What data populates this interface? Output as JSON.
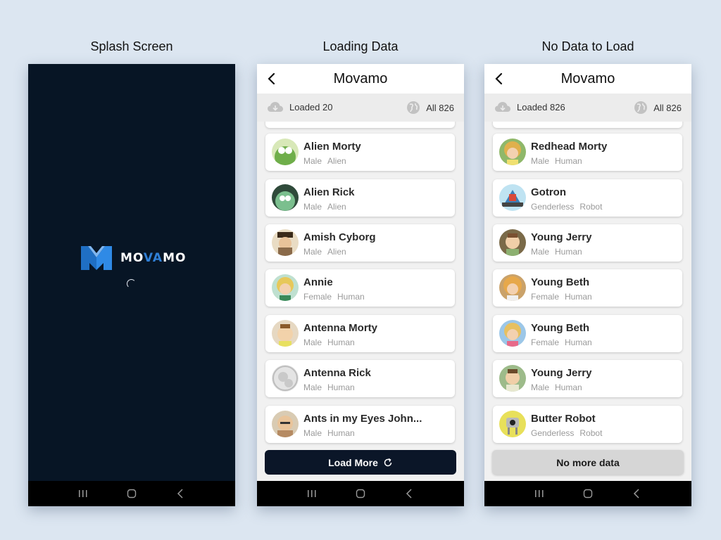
{
  "columns": {
    "splash_title": "Splash Screen",
    "loading_title": "Loading Data",
    "nodata_title": "No Data to Load"
  },
  "splash": {
    "logo_prefix": "MO",
    "logo_accent": "VA",
    "logo_suffix": "MO",
    "background_color": "#071525",
    "accent_color": "#2f7fd6"
  },
  "icons": {
    "back": "chevron-left-icon",
    "cloud": "cloud-download-icon",
    "globe": "globe-icon",
    "refresh": "refresh-icon",
    "nav_recents": "recents-icon",
    "nav_home": "home-icon",
    "nav_back": "back-icon"
  },
  "loading": {
    "app_title": "Movamo",
    "loaded_text": "Loaded 20",
    "total_text": "All 826",
    "button_label": "Load More",
    "button_color": "#0b1628",
    "characters": [
      {
        "name": "Alien Morty",
        "gender": "Male",
        "species": "Alien",
        "avatar": "#6fae4a"
      },
      {
        "name": "Alien Rick",
        "gender": "Male",
        "species": "Alien",
        "avatar": "#7bbf8e"
      },
      {
        "name": "Amish Cyborg",
        "gender": "Male",
        "species": "Alien",
        "avatar": "#8a6a4a"
      },
      {
        "name": "Annie",
        "gender": "Female",
        "species": "Human",
        "avatar": "#e7c85a"
      },
      {
        "name": "Antenna Morty",
        "gender": "Male",
        "species": "Human",
        "avatar": "#c9a56b"
      },
      {
        "name": "Antenna Rick",
        "gender": "Male",
        "species": "Human",
        "avatar": "#cfcfcf"
      },
      {
        "name": "Ants in my Eyes John...",
        "gender": "Male",
        "species": "Human",
        "avatar": "#b58a62"
      }
    ]
  },
  "nodata": {
    "app_title": "Movamo",
    "loaded_text": "Loaded 826",
    "total_text": "All 826",
    "button_label": "No more data",
    "button_color": "#d6d6d6",
    "characters": [
      {
        "name": "Redhead Morty",
        "gender": "Male",
        "species": "Human",
        "avatar": "#e0b04c"
      },
      {
        "name": "Gotron",
        "gender": "Genderless",
        "species": "Robot",
        "avatar": "#3b7fb8"
      },
      {
        "name": "Young Jerry",
        "gender": "Male",
        "species": "Human",
        "avatar": "#8c7a52"
      },
      {
        "name": "Young Beth",
        "gender": "Female",
        "species": "Human",
        "avatar": "#d8a85a"
      },
      {
        "name": "Young Beth",
        "gender": "Female",
        "species": "Human",
        "avatar": "#9cc7e8"
      },
      {
        "name": "Young Jerry",
        "gender": "Male",
        "species": "Human",
        "avatar": "#9dbb8a"
      },
      {
        "name": "Butter Robot",
        "gender": "Genderless",
        "species": "Robot",
        "avatar": "#e8e05a"
      }
    ]
  }
}
